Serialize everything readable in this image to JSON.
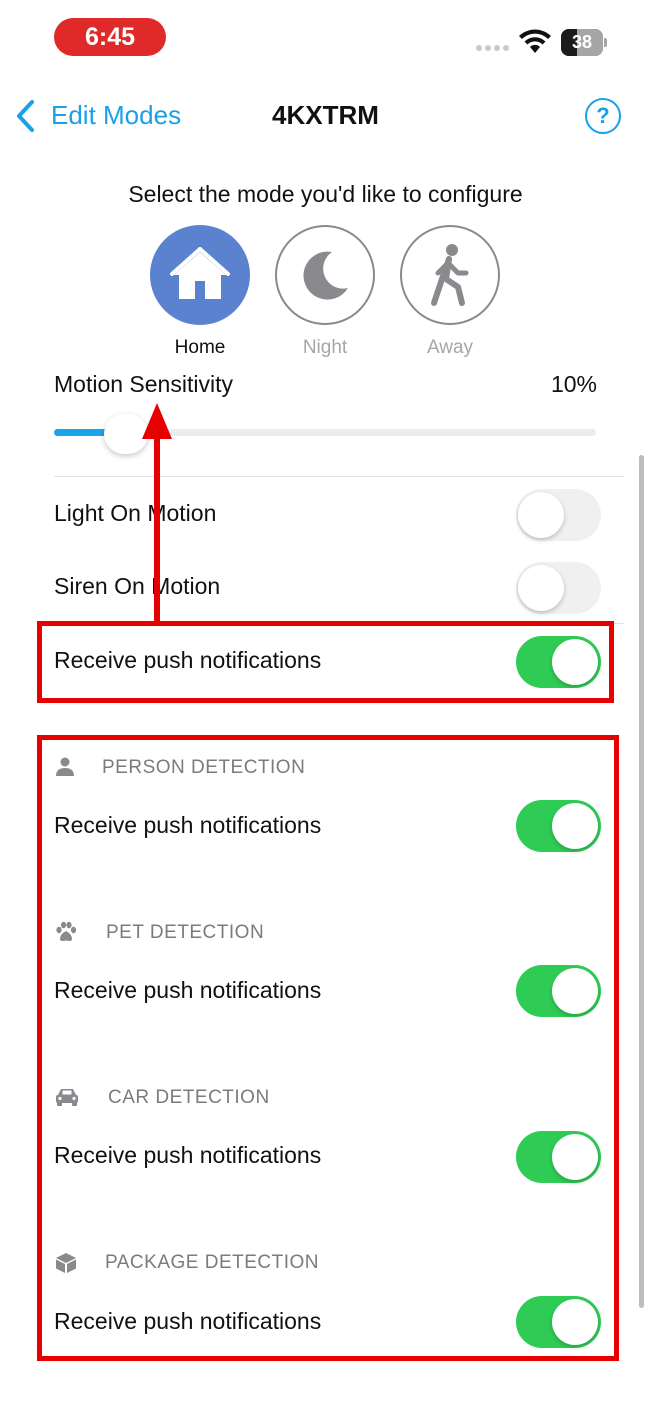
{
  "status_bar": {
    "time": "6:45",
    "battery": "38",
    "battery_level": 0.38
  },
  "nav": {
    "back_label": "Edit Modes",
    "title": "4KXTRM",
    "help_label": "?"
  },
  "mode_prompt": "Select the mode you'd like to configure",
  "modes": [
    {
      "label": "Home",
      "icon": "house-icon",
      "selected": true
    },
    {
      "label": "Night",
      "icon": "moon-icon",
      "selected": false
    },
    {
      "label": "Away",
      "icon": "walking-person-icon",
      "selected": false
    }
  ],
  "motion_sensitivity": {
    "label": "Motion Sensitivity",
    "value_text": "10%",
    "value": 0.1
  },
  "settings": [
    {
      "label": "Light On Motion",
      "on": false
    },
    {
      "label": "Siren On Motion",
      "on": false
    },
    {
      "label": "Receive push notifications",
      "on": true
    }
  ],
  "detections": [
    {
      "header": "PERSON DETECTION",
      "icon": "person-icon",
      "row_label": "Receive push notifications",
      "on": true
    },
    {
      "header": "PET DETECTION",
      "icon": "paw-icon",
      "row_label": "Receive push notifications",
      "on": true
    },
    {
      "header": "CAR DETECTION",
      "icon": "car-icon",
      "row_label": "Receive push notifications",
      "on": true
    },
    {
      "header": "PACKAGE DETECTION",
      "icon": "package-icon",
      "row_label": "Receive push notifications",
      "on": true
    }
  ],
  "colors": {
    "accent": "#1a9fe8",
    "selected_mode": "#5b82cf",
    "toggle_on": "#2fcc55",
    "highlight": "#e60000"
  }
}
